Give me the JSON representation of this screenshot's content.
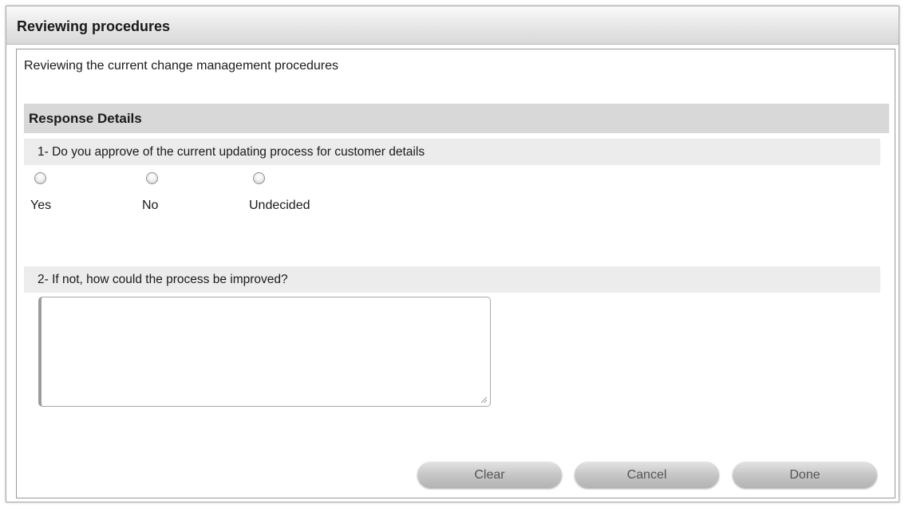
{
  "dialog": {
    "title": "Reviewing procedures",
    "description": "Reviewing the current change management procedures"
  },
  "response_details": {
    "header": "Response Details",
    "questions": [
      {
        "text": "1- Do you approve of the current updating process for customer details",
        "type": "radio",
        "options": [
          {
            "label": "Yes",
            "selected": false
          },
          {
            "label": "No",
            "selected": false
          },
          {
            "label": "Undecided",
            "selected": false
          }
        ]
      },
      {
        "text": "2- If not, how could the process be improved?",
        "type": "textarea",
        "value": "",
        "placeholder": ""
      }
    ]
  },
  "buttons": {
    "clear": "Clear",
    "cancel": "Cancel",
    "done": "Done"
  },
  "colors": {
    "section_header_bg": "#d8d8d8",
    "question_bar_bg": "#ececec",
    "button_text": "#555555"
  },
  "icons": [
    "radio-icon",
    "resize-grip-icon"
  ]
}
